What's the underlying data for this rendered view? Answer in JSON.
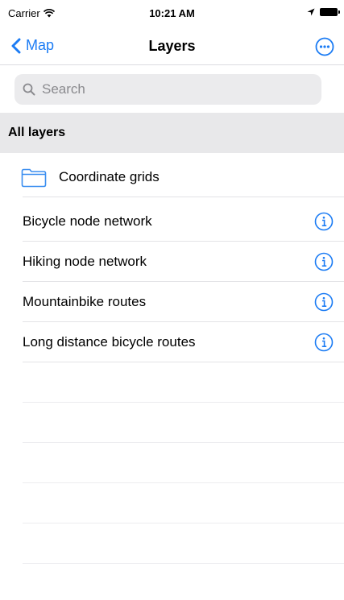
{
  "status_bar": {
    "carrier": "Carrier",
    "time": "10:21 AM"
  },
  "nav": {
    "back_label": "Map",
    "title": "Layers"
  },
  "search": {
    "placeholder": "Search"
  },
  "section": {
    "title": "All layers"
  },
  "rows": [
    {
      "label": "Coordinate grids",
      "icon": "folder-icon"
    },
    {
      "label": "Bicycle node network",
      "icon": "info-icon"
    },
    {
      "label": "Hiking node network",
      "icon": "info-icon"
    },
    {
      "label": "Mountainbike routes",
      "icon": "info-icon"
    },
    {
      "label": "Long distance bicycle routes",
      "icon": "info-icon"
    }
  ],
  "colors": {
    "accent": "#1c7cf4",
    "section_bg": "#e8e8ea",
    "search_bg": "#ebebed"
  }
}
